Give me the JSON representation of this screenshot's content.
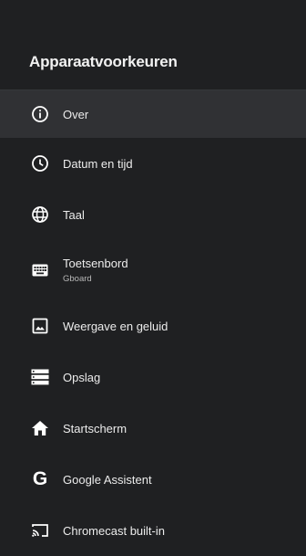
{
  "header": {
    "title": "Apparaatvoorkeuren"
  },
  "menu": {
    "items": [
      {
        "label": "Over",
        "icon": "info-icon"
      },
      {
        "label": "Datum en tijd",
        "icon": "clock-icon"
      },
      {
        "label": "Taal",
        "icon": "globe-icon"
      },
      {
        "label": "Toetsenbord",
        "sublabel": "Gboard",
        "icon": "keyboard-icon"
      },
      {
        "label": "Weergave en geluid",
        "icon": "picture-icon"
      },
      {
        "label": "Opslag",
        "icon": "storage-icon"
      },
      {
        "label": "Startscherm",
        "icon": "home-icon"
      },
      {
        "label": "Google Assistent",
        "icon": "google-g-icon"
      },
      {
        "label": "Chromecast built-in",
        "icon": "cast-icon"
      }
    ]
  },
  "colors": {
    "background": "#1f2022",
    "selected_row": "#303134",
    "text": "#ececec"
  }
}
